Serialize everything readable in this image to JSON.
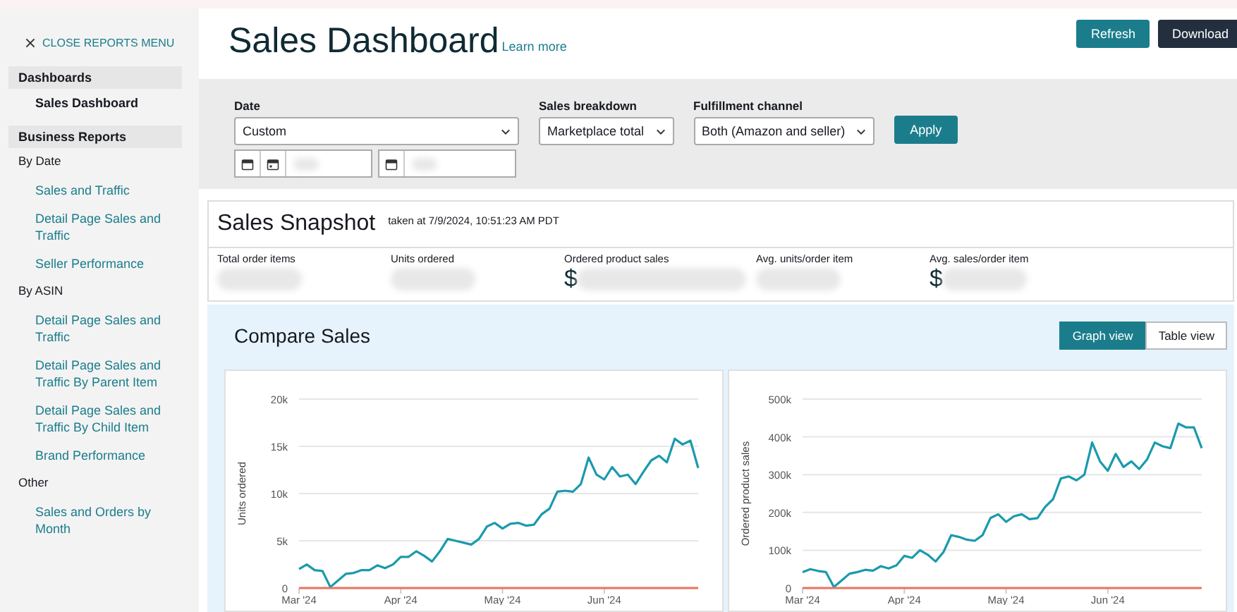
{
  "sidebar": {
    "close_link": "CLOSE REPORTS MENU",
    "groups": [
      {
        "title": "Dashboards",
        "sections": [
          {
            "items": [
              {
                "label": "Sales Dashboard",
                "selected": true
              }
            ]
          }
        ]
      },
      {
        "title": "Business Reports",
        "sections": [
          {
            "heading": "By Date",
            "items": [
              {
                "label": "Sales and Traffic",
                "selected": false
              },
              {
                "label": "Detail Page Sales and Traffic",
                "selected": false
              },
              {
                "label": "Seller Performance",
                "selected": false
              }
            ]
          },
          {
            "heading": "By ASIN",
            "items": [
              {
                "label": "Detail Page Sales and Traffic",
                "selected": false
              },
              {
                "label": "Detail Page Sales and Traffic By Parent Item",
                "selected": false
              },
              {
                "label": "Detail Page Sales and Traffic By Child Item",
                "selected": false
              },
              {
                "label": "Brand Performance",
                "selected": false
              }
            ]
          },
          {
            "heading": "Other",
            "items": [
              {
                "label": "Sales and Orders by Month",
                "selected": false
              }
            ]
          }
        ]
      }
    ]
  },
  "header": {
    "title": "Sales Dashboard",
    "learn_more": "Learn more",
    "buttons": [
      {
        "label": "Refresh",
        "kind": "primary"
      },
      {
        "label": "Download",
        "kind": "dark"
      }
    ]
  },
  "filters": {
    "date": {
      "label": "Date",
      "value": "Custom"
    },
    "sales_breakdown": {
      "label": "Sales breakdown",
      "value": "Marketplace total"
    },
    "fulfillment_channel": {
      "label": "Fulfillment channel",
      "value": "Both (Amazon and seller)"
    },
    "apply": "Apply"
  },
  "snapshot": {
    "title": "Sales Snapshot",
    "taken_at": "taken at 7/9/2024, 10:51:23 AM PDT",
    "metrics": [
      {
        "label": "Total order items"
      },
      {
        "label": "Units ordered"
      },
      {
        "label": "Ordered product sales",
        "value_prefix": "$"
      },
      {
        "label": "Avg. units/order item"
      },
      {
        "label": "Avg. sales/order item",
        "value_prefix": "$"
      }
    ]
  },
  "compare_sales": {
    "title": "Compare Sales",
    "views": [
      {
        "label": "Graph view",
        "selected": true
      },
      {
        "label": "Table view",
        "selected": false
      }
    ],
    "charts": [
      {
        "chart_data": {
          "type": "line",
          "grid": true,
          "ylabel": "Units ordered",
          "categories": [
            "Mar '24",
            null,
            null,
            null,
            null,
            null,
            null,
            null,
            null,
            null,
            null,
            null,
            null,
            "Apr '24",
            null,
            null,
            null,
            null,
            null,
            null,
            null,
            null,
            null,
            null,
            null,
            null,
            "May '24",
            null,
            null,
            null,
            null,
            null,
            null,
            null,
            null,
            null,
            null,
            null,
            null,
            "Jun '24",
            null,
            null,
            null,
            null,
            null,
            null,
            null,
            null,
            null,
            null,
            null,
            null
          ],
          "ylim": [
            0,
            20000
          ],
          "yticks": [
            {
              "value": 0,
              "label": "0"
            },
            {
              "value": 5000,
              "label": "5k"
            },
            {
              "value": 10000,
              "label": "10k"
            },
            {
              "value": 15000,
              "label": "15k"
            },
            {
              "value": 20000,
              "label": "20k"
            }
          ],
          "series": [
            {
              "color": "#1a9aad",
              "values": [
                2000,
                2500,
                1900,
                1800,
                100,
                800,
                1500,
                1600,
                1900,
                1900,
                2400,
                2100,
                2500,
                3300,
                3300,
                3900,
                3400,
                2800,
                3900,
                5200,
                5000,
                4800,
                4600,
                5200,
                6500,
                6900,
                6300,
                6800,
                6900,
                6600,
                6700,
                7800,
                8400,
                10200,
                10300,
                10200,
                11000,
                13800,
                12000,
                11500,
                12800,
                11800,
                12000,
                11000,
                12300,
                13500,
                14000,
                13300,
                15800,
                15200,
                15600,
                12700
              ]
            },
            {
              "color": "#e8735f",
              "values": [
                0,
                0,
                0,
                0,
                0,
                0,
                0,
                0,
                0,
                0,
                0,
                0,
                0,
                0,
                0,
                0,
                0,
                0,
                0,
                0,
                0,
                0,
                0,
                0,
                0,
                0,
                0,
                0,
                0,
                0,
                0,
                0,
                0,
                0,
                0,
                0,
                0,
                0,
                0,
                0,
                0,
                0,
                0,
                0,
                0,
                0,
                0,
                0,
                0,
                0,
                0,
                0
              ]
            }
          ]
        }
      },
      {
        "chart_data": {
          "type": "line",
          "grid": true,
          "ylabel": "Ordered product sales",
          "categories": [
            "Mar '24",
            null,
            null,
            null,
            null,
            null,
            null,
            null,
            null,
            null,
            null,
            null,
            null,
            "Apr '24",
            null,
            null,
            null,
            null,
            null,
            null,
            null,
            null,
            null,
            null,
            null,
            null,
            "May '24",
            null,
            null,
            null,
            null,
            null,
            null,
            null,
            null,
            null,
            null,
            null,
            null,
            "Jun '24",
            null,
            null,
            null,
            null,
            null,
            null,
            null,
            null,
            null,
            null,
            null,
            null
          ],
          "ylim": [
            0,
            500000
          ],
          "yticks": [
            {
              "value": 0,
              "label": "0"
            },
            {
              "value": 100000,
              "label": "100k"
            },
            {
              "value": 200000,
              "label": "200k"
            },
            {
              "value": 300000,
              "label": "300k"
            },
            {
              "value": 400000,
              "label": "400k"
            },
            {
              "value": 500000,
              "label": "500k"
            }
          ],
          "series": [
            {
              "color": "#1a9aad",
              "values": [
                42000,
                50000,
                45000,
                42000,
                3000,
                20000,
                38000,
                42000,
                48000,
                46000,
                58000,
                52000,
                60000,
                85000,
                80000,
                100000,
                88000,
                70000,
                95000,
                140000,
                135000,
                128000,
                125000,
                140000,
                185000,
                195000,
                175000,
                190000,
                195000,
                182000,
                185000,
                215000,
                235000,
                290000,
                295000,
                285000,
                300000,
                385000,
                335000,
                310000,
                355000,
                320000,
                335000,
                315000,
                340000,
                385000,
                375000,
                370000,
                435000,
                425000,
                425000,
                370000
              ]
            },
            {
              "color": "#e8735f",
              "values": [
                0,
                0,
                0,
                0,
                0,
                0,
                0,
                0,
                0,
                0,
                0,
                0,
                0,
                0,
                0,
                0,
                0,
                0,
                0,
                0,
                0,
                0,
                0,
                0,
                0,
                0,
                0,
                0,
                0,
                0,
                0,
                0,
                0,
                0,
                0,
                0,
                0,
                0,
                0,
                0,
                0,
                0,
                0,
                0,
                0,
                0,
                0,
                0,
                0,
                0,
                0,
                0
              ]
            }
          ]
        }
      }
    ]
  }
}
